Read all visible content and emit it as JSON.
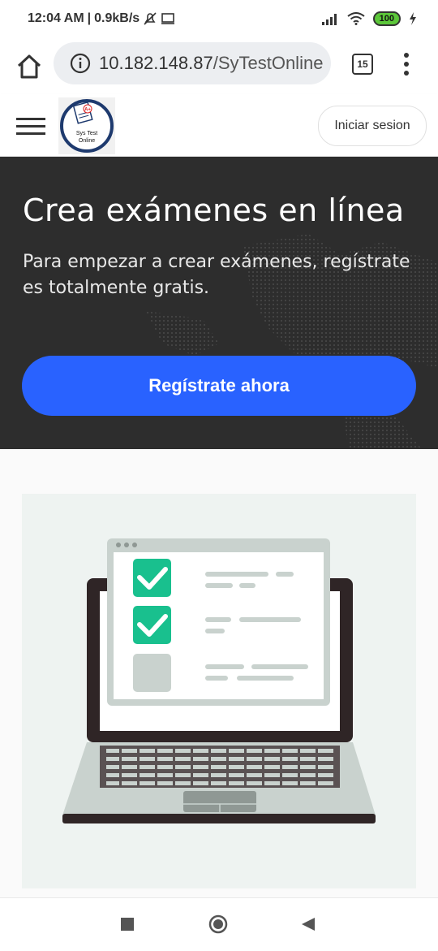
{
  "status_bar": {
    "time": "12:04 AM",
    "network_speed": "0.9kB/s",
    "battery": "100",
    "icons": [
      "alarm-off-icon",
      "screen-icon",
      "signal-icon",
      "wifi-icon",
      "battery-icon",
      "charging-icon"
    ]
  },
  "browser": {
    "url_host": "10.182.148.87",
    "url_path": "/SyTestOnline",
    "tab_count": "15",
    "icons": [
      "home-icon",
      "info-icon",
      "more-vert-icon"
    ]
  },
  "header": {
    "logo_line1": "Sys Test",
    "logo_line2": "Online",
    "logo_grade": "A+",
    "signin_label": "Iniciar sesion",
    "icons": [
      "hamburger-menu-icon"
    ]
  },
  "hero": {
    "title": "Crea exámenes en línea",
    "subtitle": "Para empezar a crear exámenes, regístrate es totalmente gratis.",
    "cta_label": "Regístrate ahora"
  },
  "illustration": {
    "checklist_state": [
      "checked",
      "checked",
      "unchecked"
    ],
    "icons": [
      "laptop-checklist-illustration"
    ]
  },
  "navbar": {
    "icons": [
      "recents-square-icon",
      "home-circle-icon",
      "back-triangle-icon"
    ]
  },
  "colors": {
    "hero_bg": "#2d2d2d",
    "cta_bg": "#2962ff",
    "check_green": "#19c08e",
    "logo_ring": "#1e3a6e"
  }
}
